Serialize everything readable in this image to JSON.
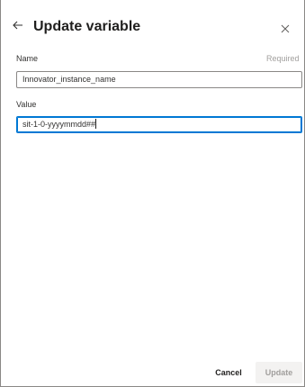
{
  "dialog": {
    "title": "Update variable",
    "back_icon": "arrow-left-icon",
    "close_icon": "close-icon"
  },
  "form": {
    "name": {
      "label": "Name",
      "required_text": "Required",
      "value": "Innovator_instance_name"
    },
    "value": {
      "label": "Value",
      "value": "sit-1-0-yyyymmdd##"
    }
  },
  "footer": {
    "cancel_label": "Cancel",
    "update_label": "Update"
  },
  "colors": {
    "accent": "#0078d4",
    "border": "#8a8886",
    "disabled_text": "#a19f9d",
    "disabled_bg": "#f3f2f1"
  }
}
